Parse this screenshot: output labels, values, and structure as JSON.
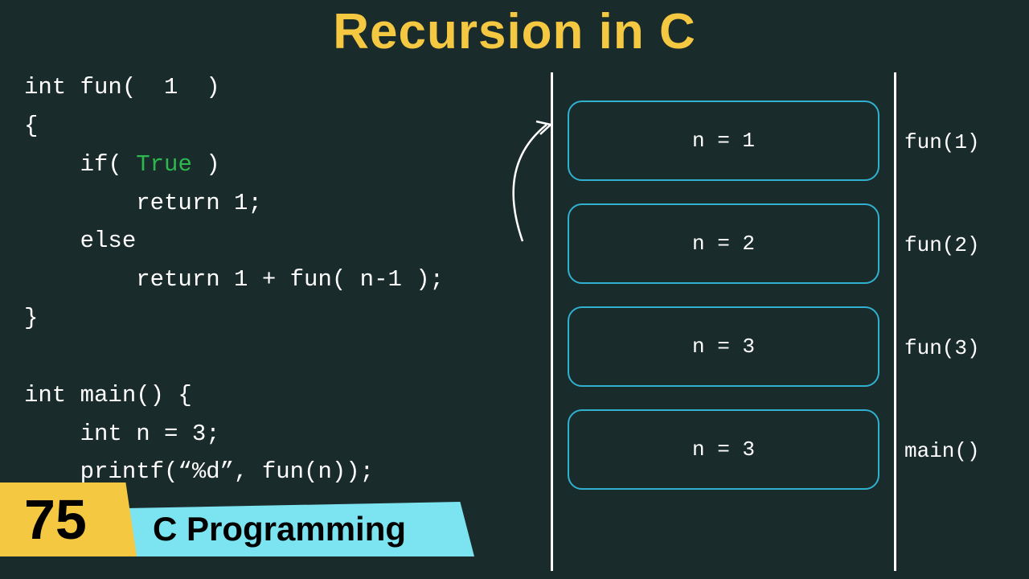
{
  "title": "Recursion in C",
  "code": {
    "line1": "int fun(  1  )",
    "line2": "{",
    "line3a": "    if( ",
    "line3b": "True",
    "line3c": " )",
    "line4": "        return 1;",
    "line5": "    else",
    "line6": "        return 1 + fun( n-1 );",
    "line7": "}",
    "line8": "",
    "line9": "int main() {",
    "line10": "    int n = 3;",
    "line11": "    printf(“%d”, fun(n));"
  },
  "stack": {
    "frames": [
      {
        "content": "n = 1",
        "label": "fun(1)"
      },
      {
        "content": "n = 2",
        "label": "fun(2)"
      },
      {
        "content": "n = 3",
        "label": "fun(3)"
      },
      {
        "content": "n = 3",
        "label": "main()"
      }
    ]
  },
  "banner": {
    "number": "75",
    "series": "C Programming"
  }
}
